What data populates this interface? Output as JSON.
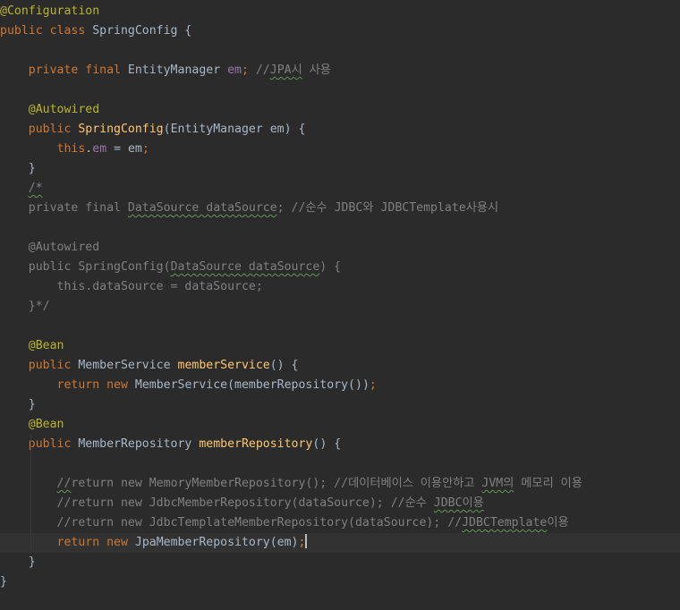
{
  "editor": {
    "lines": [
      {
        "tokens": [
          {
            "text": "@Configuration",
            "cls": "ann"
          }
        ]
      },
      {
        "tokens": [
          {
            "text": "public class ",
            "cls": "kw"
          },
          {
            "text": "SpringConfig {"
          }
        ]
      },
      {
        "tokens": []
      },
      {
        "tokens": [
          {
            "text": "    "
          },
          {
            "text": "private final ",
            "cls": "kw"
          },
          {
            "text": "EntityManager "
          },
          {
            "text": "em",
            "cls": "field"
          },
          {
            "text": "; ",
            "cls": "kw"
          },
          {
            "text": "//",
            "cls": "cmt"
          },
          {
            "text": "JPA시",
            "cls": "cmt typo"
          },
          {
            "text": " 사용",
            "cls": "cmt"
          }
        ]
      },
      {
        "tokens": []
      },
      {
        "tokens": [
          {
            "text": "    "
          },
          {
            "text": "@Autowired",
            "cls": "ann"
          }
        ]
      },
      {
        "tokens": [
          {
            "text": "    "
          },
          {
            "text": "public ",
            "cls": "kw"
          },
          {
            "text": "SpringConfig",
            "cls": "fn"
          },
          {
            "text": "(EntityManager em) {"
          }
        ]
      },
      {
        "tokens": [
          {
            "text": "        "
          },
          {
            "text": "this",
            "cls": "kw"
          },
          {
            "text": "."
          },
          {
            "text": "em",
            "cls": "field"
          },
          {
            "text": " = em"
          },
          {
            "text": ";",
            "cls": "kw"
          }
        ]
      },
      {
        "tokens": [
          {
            "text": "    }"
          }
        ]
      },
      {
        "tokens": [
          {
            "text": "    "
          },
          {
            "text": "/*",
            "cls": "cmt typo"
          }
        ]
      },
      {
        "tokens": [
          {
            "text": "    private final ",
            "cls": "cmt"
          },
          {
            "text": "DataSource dataSource",
            "cls": "cmt typo"
          },
          {
            "text": "; //순수 JDBC와 JDBCTemplate사용시",
            "cls": "cmt"
          }
        ]
      },
      {
        "tokens": []
      },
      {
        "tokens": [
          {
            "text": "    @Autowired",
            "cls": "cmt"
          }
        ]
      },
      {
        "tokens": [
          {
            "text": "    public SpringConfig(",
            "cls": "cmt"
          },
          {
            "text": "DataSource dataSource",
            "cls": "cmt typo"
          },
          {
            "text": ") {",
            "cls": "cmt"
          }
        ]
      },
      {
        "tokens": [
          {
            "text": "        this.dataSource = dataSource;",
            "cls": "cmt"
          }
        ]
      },
      {
        "tokens": [
          {
            "text": "    }*/",
            "cls": "cmt"
          }
        ]
      },
      {
        "tokens": []
      },
      {
        "tokens": [
          {
            "text": "    "
          },
          {
            "text": "@Bean",
            "cls": "ann"
          }
        ]
      },
      {
        "tokens": [
          {
            "text": "    "
          },
          {
            "text": "public ",
            "cls": "kw"
          },
          {
            "text": "MemberService "
          },
          {
            "text": "memberService",
            "cls": "fn"
          },
          {
            "text": "() {"
          }
        ]
      },
      {
        "tokens": [
          {
            "text": "        "
          },
          {
            "text": "return new ",
            "cls": "kw"
          },
          {
            "text": "MemberService(memberRepository())"
          },
          {
            "text": ";",
            "cls": "kw"
          }
        ]
      },
      {
        "tokens": [
          {
            "text": "    }"
          }
        ]
      },
      {
        "tokens": [
          {
            "text": "    "
          },
          {
            "text": "@Bean",
            "cls": "ann"
          }
        ]
      },
      {
        "tokens": [
          {
            "text": "    "
          },
          {
            "text": "public ",
            "cls": "kw"
          },
          {
            "text": "MemberRepository "
          },
          {
            "text": "memberRepository",
            "cls": "fn"
          },
          {
            "text": "() {"
          }
        ]
      },
      {
        "tokens": []
      },
      {
        "tokens": [
          {
            "text": "        "
          },
          {
            "text": "//",
            "cls": "cmt typo"
          },
          {
            "text": "return new MemoryMemberRepository(); //데이터베이스 이용안하고 ",
            "cls": "cmt"
          },
          {
            "text": "JVM의",
            "cls": "cmt typo"
          },
          {
            "text": " 메모리 이용",
            "cls": "cmt"
          }
        ]
      },
      {
        "tokens": [
          {
            "text": "        "
          },
          {
            "text": "//return new JdbcMemberRepository(dataSource); //순수 ",
            "cls": "cmt"
          },
          {
            "text": "JDBC이용",
            "cls": "cmt typo"
          }
        ]
      },
      {
        "tokens": [
          {
            "text": "        "
          },
          {
            "text": "//return new JdbcTemplateMemberRepository(dataSource); //",
            "cls": "cmt"
          },
          {
            "text": "JDBCTemplate",
            "cls": "cmt typo"
          },
          {
            "text": "이용",
            "cls": "cmt"
          }
        ]
      },
      {
        "tokens": [
          {
            "text": "        "
          },
          {
            "text": "return new ",
            "cls": "kw"
          },
          {
            "text": "JpaMemberRepository(em)"
          },
          {
            "text": ";",
            "cls": "kw"
          }
        ],
        "current": true
      },
      {
        "tokens": [
          {
            "text": "    }"
          }
        ]
      },
      {
        "tokens": [
          {
            "text": "}"
          }
        ]
      }
    ]
  }
}
